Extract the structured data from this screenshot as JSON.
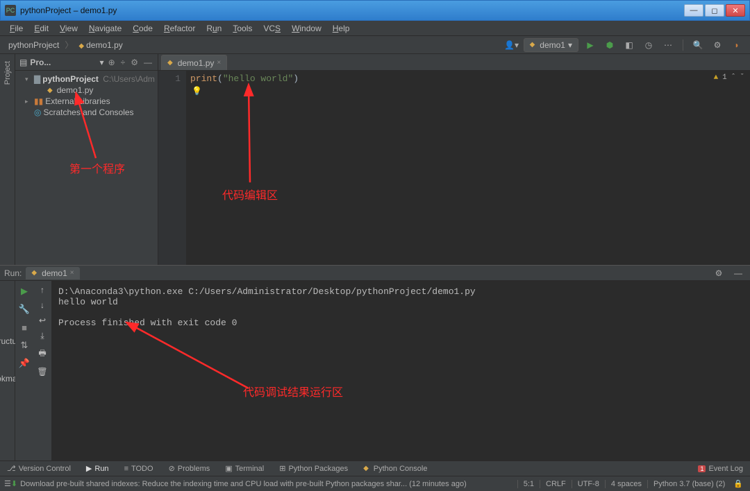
{
  "window": {
    "title": "pythonProject – demo1.py"
  },
  "menu": {
    "file": "File",
    "edit": "Edit",
    "view": "View",
    "navigate": "Navigate",
    "code": "Code",
    "refactor": "Refactor",
    "run": "Run",
    "tools": "Tools",
    "vcs": "VCS",
    "window": "Window",
    "help": "Help"
  },
  "breadcrumb": {
    "project": "pythonProject",
    "file": "demo1.py"
  },
  "runconfig": {
    "selected": "demo1"
  },
  "project_panel": {
    "title": "Pro...",
    "root": "pythonProject",
    "root_path": "C:\\Users\\Adm",
    "file": "demo1.py",
    "external": "External Libraries",
    "scratches": "Scratches and Consoles"
  },
  "editor": {
    "tab": "demo1.py",
    "line_no": "1",
    "code_fn": "print",
    "code_open": "(",
    "code_str": "\"hello world\"",
    "code_close": ")",
    "warnings": "1"
  },
  "run": {
    "label": "Run:",
    "tab": "demo1",
    "output_cmd": "D:\\Anaconda3\\python.exe C:/Users/Administrator/Desktop/pythonProject/demo1.py",
    "output_line": "hello world",
    "output_exit": "Process finished with exit code 0"
  },
  "bottom": {
    "vcs": "Version Control",
    "run": "Run",
    "todo": "TODO",
    "problems": "Problems",
    "terminal": "Terminal",
    "packages": "Python Packages",
    "console": "Python Console",
    "eventlog": "Event Log",
    "eventcount": "1"
  },
  "status": {
    "message": "Download pre-built shared indexes: Reduce the indexing time and CPU load with pre-built Python packages shar... (12 minutes ago)",
    "pos": "5:1",
    "sep": "CRLF",
    "enc": "UTF-8",
    "indent": "4 spaces",
    "interp": "Python 3.7 (base) (2)"
  },
  "left_tabs": {
    "project": "Project",
    "structure": "Structure",
    "bookmarks": "Bookmarks"
  },
  "annotations": {
    "a1": "第一个程序",
    "a2": "代码编辑区",
    "a3": "代码调试结果运行区"
  }
}
